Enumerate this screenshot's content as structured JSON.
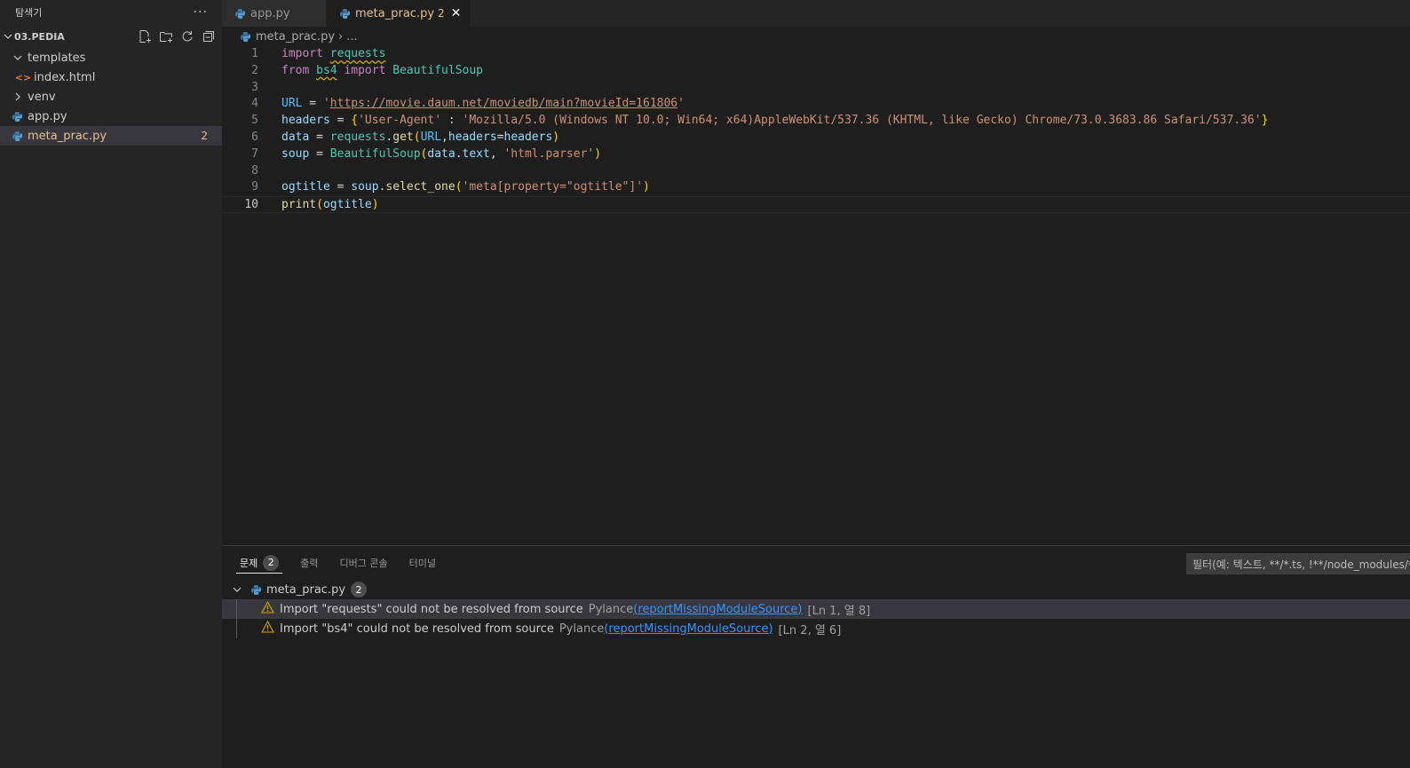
{
  "sidebar": {
    "title": "탐색기",
    "more": "···",
    "folder": "03.PEDIA",
    "items": [
      {
        "label": "templates",
        "kind": "folder-open"
      },
      {
        "label": "index.html",
        "kind": "html"
      },
      {
        "label": "venv",
        "kind": "folder-closed"
      },
      {
        "label": "app.py",
        "kind": "python"
      },
      {
        "label": "meta_prac.py",
        "kind": "python",
        "badge": "2"
      }
    ]
  },
  "tabs": [
    {
      "label": "app.py"
    },
    {
      "label": "meta_prac.py",
      "count": "2",
      "close": "✕"
    }
  ],
  "breadcrumb": {
    "file": "meta_prac.py",
    "sep": "›",
    "rest": "..."
  },
  "editor": {
    "line_numbers": [
      "1",
      "2",
      "3",
      "4",
      "5",
      "6",
      "7",
      "8",
      "9",
      "10"
    ],
    "lines": {
      "l1": {
        "kw": "import",
        "mod": "requests"
      },
      "l2": {
        "kw1": "from",
        "mod": "bs4",
        "kw2": "import",
        "cls": "BeautifulSoup"
      },
      "l4": {
        "var": "URL",
        "op": " = ",
        "q1": "'",
        "url": "https://movie.daum.net/moviedb/main?movieId=161806",
        "q2": "'"
      },
      "l5": {
        "var": "headers",
        "op": " = ",
        "open": "{",
        "key": "'User-Agent'",
        "colon": " : ",
        "val": "'Mozilla/5.0 (Windows NT 10.0; Win64; x64)AppleWebKit/537.36 (KHTML, like Gecko) Chrome/73.0.3683.86 Safari/537.36'",
        "close": "}"
      },
      "l6": {
        "var": "data",
        "op": " = ",
        "obj": "requests",
        "dot": ".",
        "fn": "get",
        "open": "(",
        "arg1": "URL",
        "comma": ",",
        "arg2": "headers",
        "eq": "=",
        "arg3": "headers",
        "close": ")"
      },
      "l7": {
        "var": "soup",
        "op": " = ",
        "cls": "BeautifulSoup",
        "open": "(",
        "arg1": "data",
        "dot": ".",
        "attr": "text",
        "comma": ", ",
        "str": "'html.parser'",
        "close": ")"
      },
      "l9": {
        "var": "ogtitle",
        "op": " = ",
        "obj": "soup",
        "dot": ".",
        "fn": "select_one",
        "open": "(",
        "str": "'meta[property=\"ogtitle\"]'",
        "close": ")"
      },
      "l10": {
        "fn": "print",
        "open": "(",
        "arg": "ogtitle",
        "close": ")"
      }
    }
  },
  "panel": {
    "tabs": [
      {
        "label": "문제",
        "badge": "2"
      },
      {
        "label": "출력"
      },
      {
        "label": "디버그 콘솔"
      },
      {
        "label": "터미널"
      }
    ],
    "filter_placeholder": "필터(예: 텍스트, **/*.ts, !**/node_modules/**)",
    "file": {
      "name": "meta_prac.py",
      "count": "2"
    },
    "problems": [
      {
        "message": "Import \"requests\" could not be resolved from source",
        "source": "Pylance",
        "code": "reportMissingModuleSource",
        "location": "[Ln 1, 열 8]"
      },
      {
        "message": "Import \"bs4\" could not be resolved from source",
        "source": "Pylance",
        "code": "reportMissingModuleSource",
        "location": "[Ln 2, 열 6]"
      }
    ]
  },
  "colors": {
    "modified": "#e2c08d",
    "warning": "#cca700",
    "link": "#3794ff",
    "background": "#1e1e1e",
    "sidebar": "#252526"
  },
  "icons": [
    "python-icon",
    "html-icon",
    "chevron-down-icon",
    "chevron-right-icon",
    "new-file-icon",
    "new-folder-icon",
    "refresh-icon",
    "collapse-all-icon",
    "close-icon",
    "warning-icon",
    "more-icon"
  ]
}
